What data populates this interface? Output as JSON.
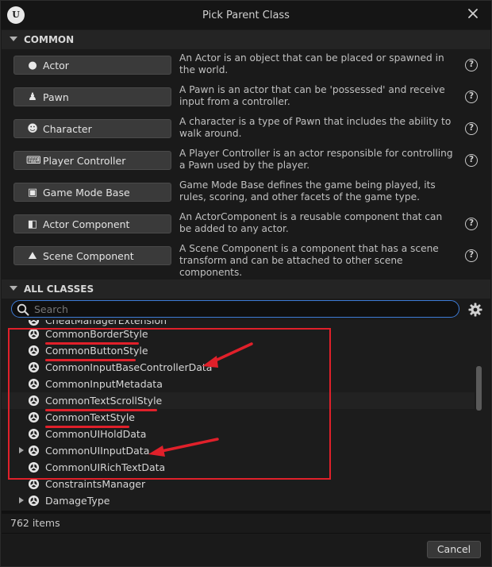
{
  "dialog": {
    "title": "Pick Parent Class",
    "logo_text": "U",
    "close_glyph": "✕"
  },
  "common": {
    "header": "COMMON",
    "items": [
      {
        "label": "Actor",
        "icon": "actor-icon",
        "glyph": "●",
        "description": "An Actor is an object that can be placed or spawned in the world.",
        "help": true
      },
      {
        "label": "Pawn",
        "icon": "pawn-icon",
        "glyph": "♟",
        "description": "A Pawn is an actor that can be 'possessed' and receive input from a controller.",
        "help": true
      },
      {
        "label": "Character",
        "icon": "character-icon",
        "glyph": "☻",
        "description": "A character is a type of Pawn that includes the ability to walk around.",
        "help": true
      },
      {
        "label": "Player Controller",
        "icon": "gamepad-icon",
        "glyph": "⌨",
        "description": "A Player Controller is an actor responsible for controlling a Pawn used by the player.",
        "help": true
      },
      {
        "label": "Game Mode Base",
        "icon": "game-mode-icon",
        "glyph": "▣",
        "description": "Game Mode Base defines the game being played, its rules, scoring, and other facets of the game type.",
        "help": false
      },
      {
        "label": "Actor Component",
        "icon": "actor-component-icon",
        "glyph": "◧",
        "description": "An ActorComponent is a reusable component that can be added to any actor.",
        "help": true
      },
      {
        "label": "Scene Component",
        "icon": "scene-component-icon",
        "glyph": "⛰",
        "description": "A Scene Component is a component that has a scene transform and can be attached to other scene components.",
        "help": true
      }
    ],
    "help_glyph": "?"
  },
  "all_classes": {
    "header": "ALL CLASSES",
    "search_placeholder": "Search",
    "rows": [
      {
        "name": "CheatManagerExtension",
        "expandable": false,
        "partial": true
      },
      {
        "name": "CommonBorderStyle",
        "expandable": false
      },
      {
        "name": "CommonButtonStyle",
        "expandable": false
      },
      {
        "name": "CommonInputBaseControllerData",
        "expandable": false
      },
      {
        "name": "CommonInputMetadata",
        "expandable": false
      },
      {
        "name": "CommonTextScrollStyle",
        "expandable": false
      },
      {
        "name": "CommonTextStyle",
        "expandable": false
      },
      {
        "name": "CommonUIHoldData",
        "expandable": false
      },
      {
        "name": "CommonUIInputData",
        "expandable": true
      },
      {
        "name": "CommonUIRichTextData",
        "expandable": false
      },
      {
        "name": "ConstraintsManager",
        "expandable": false
      },
      {
        "name": "DamageType",
        "expandable": true
      }
    ],
    "count_label": "762 items"
  },
  "footer": {
    "cancel_label": "Cancel"
  },
  "colors": {
    "annotation_red": "#e0202a",
    "search_focus_blue": "#3d7bd6"
  }
}
